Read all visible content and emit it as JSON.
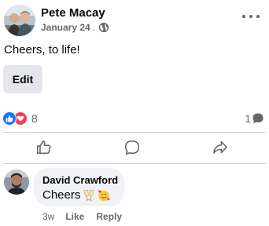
{
  "post": {
    "author": "Pete Macay",
    "date": "January 24",
    "separator": ".",
    "privacy_icon": "globe-icon",
    "more_icon": "more-options-icon",
    "text": "Cheers, to life!",
    "edit_label": "Edit"
  },
  "reactions": {
    "icons": [
      "like-reaction-icon",
      "love-reaction-icon"
    ],
    "count": "8",
    "comments_count": "1",
    "comments_icon": "comment-bubble-icon"
  },
  "actions": {
    "icons": [
      "like-icon",
      "comment-icon",
      "share-icon"
    ]
  },
  "comment": {
    "author": "David Crawford",
    "text": "Cheers",
    "emoji_icons": [
      "clinking-glasses-emoji",
      "smiling-face-with-hearts-emoji"
    ],
    "time": "3w",
    "like_label": "Like",
    "reply_label": "Reply"
  },
  "colors": {
    "like_blue": "#1877f2",
    "love_red": "#f33e58",
    "secondary_text": "#65676b",
    "button_bg": "#e4e6eb",
    "bubble_bg": "#f0f2f5"
  }
}
